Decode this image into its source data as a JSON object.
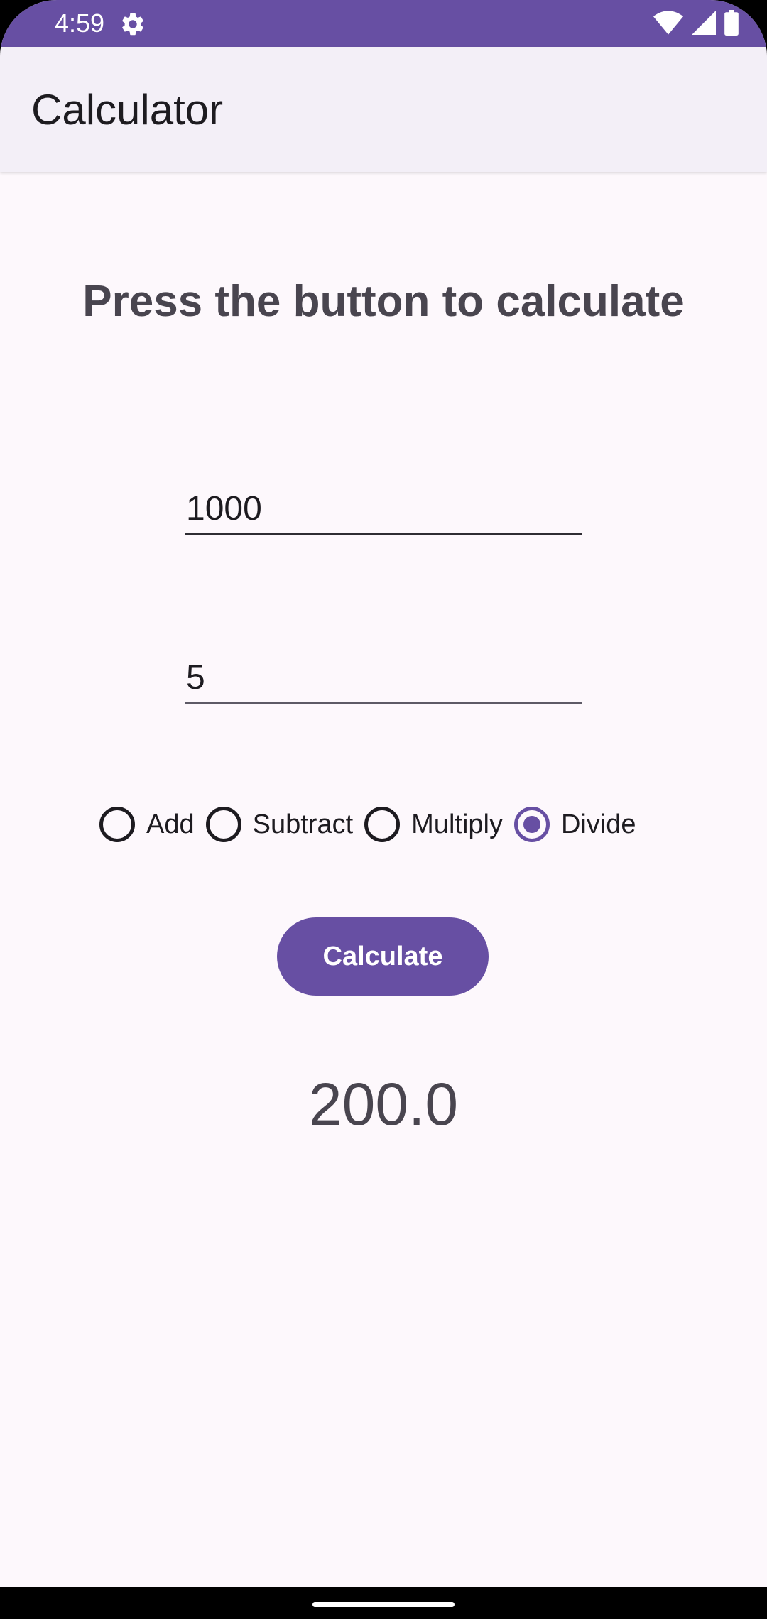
{
  "status_bar": {
    "time": "4:59",
    "icons": [
      "settings-gear-icon",
      "wifi-icon",
      "cellular-signal-icon",
      "battery-icon"
    ],
    "background": "#674fa3"
  },
  "app_bar": {
    "title": "Calculator"
  },
  "main": {
    "heading": "Press the button to calculate",
    "input_first": {
      "value": "1000"
    },
    "input_second": {
      "value": "5"
    },
    "operations": [
      {
        "label": "Add",
        "checked": false
      },
      {
        "label": "Subtract",
        "checked": false
      },
      {
        "label": "Multiply",
        "checked": false
      },
      {
        "label": "Divide",
        "checked": true
      }
    ],
    "calculate_label": "Calculate",
    "result": "200.0"
  },
  "colors": {
    "accent": "#674fa3",
    "background": "#fdf8fc",
    "app_bar": "#f3eff7",
    "text_primary": "#1d1b20",
    "text_secondary": "#49454f"
  }
}
